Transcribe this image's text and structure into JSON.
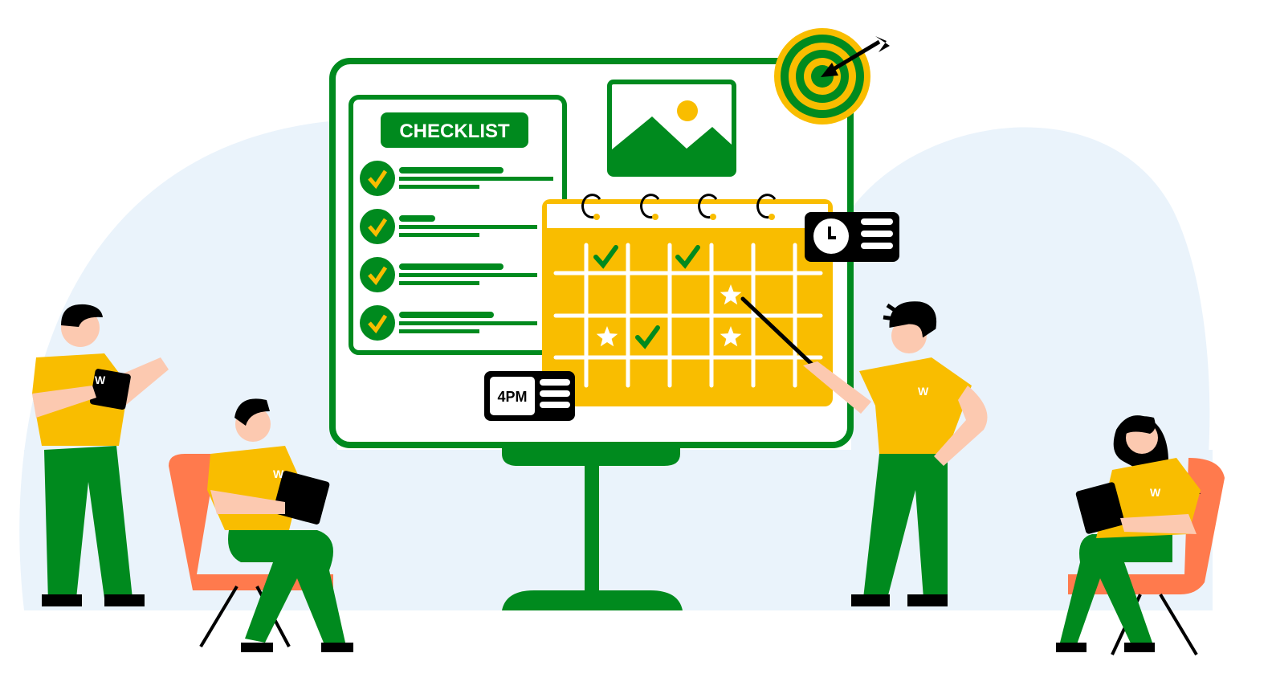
{
  "colors": {
    "green": "#008a1e",
    "yellow": "#f9bd00",
    "background_blob": "#eaf3fb",
    "chair": "#ff7a4d",
    "skin": "#fcc9b0",
    "black": "#000000"
  },
  "board": {
    "checklist_title": "CHECKLIST",
    "checklist_items": 4,
    "time_badge": "4PM"
  },
  "calendar": {
    "icons": [
      "check-icon",
      "check-icon",
      "star-icon",
      "star-icon",
      "check-icon",
      "star-icon"
    ]
  },
  "people": [
    {
      "role": "standing-with-tablet",
      "shirt_logo": "W"
    },
    {
      "role": "sitting-with-tablet",
      "shirt_logo": "W"
    },
    {
      "role": "presenter-with-pointer",
      "shirt_logo": "W"
    },
    {
      "role": "sitting-woman-with-tablet",
      "shirt_logo": "W"
    }
  ]
}
